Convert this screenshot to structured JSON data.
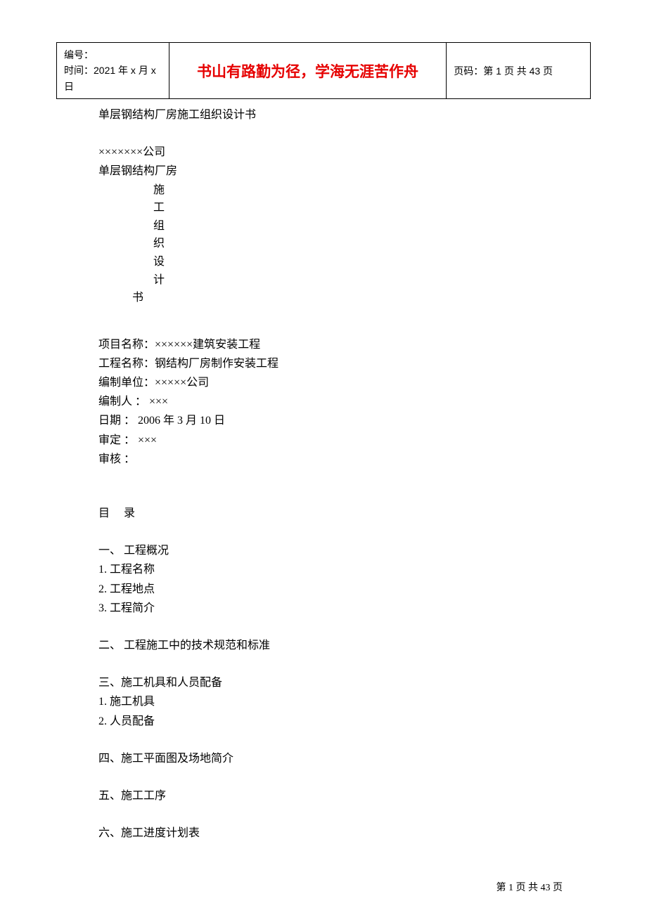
{
  "header": {
    "left_line1": "编号：",
    "left_line2": "时间：2021 年 x 月 x 日",
    "center": "书山有路勤为径，学海无涯苦作舟",
    "right": "页码：第 1 页  共 43 页"
  },
  "doc_title": "单层钢结构厂房施工组织设计书",
  "company_line": "×××××××公司",
  "subtitle": "单层钢结构厂房",
  "vertical_chars": [
    "施",
    "工",
    "组",
    "织",
    "设",
    "计"
  ],
  "vertical_last": "书",
  "info": {
    "project_name": "项目名称：××××××建筑安装工程",
    "engineering_name": "工程名称：钢结构厂房制作安装工程",
    "compile_unit": "编制单位：×××××公司",
    "compiler": "编制人  ：      ×××",
    "date": "日期  ：     2006 年 3 月 10 日",
    "approver": "审定  ：    ×××",
    "reviewer": "审核  ："
  },
  "toc_title": "目       录",
  "toc": {
    "sec1": {
      "head": "一、   工程概况",
      "items": [
        "1.             工程名称",
        "2.             工程地点",
        "3.             工程简介"
      ]
    },
    "sec2": "二、   工程施工中的技术规范和标准",
    "sec3": {
      "head": "三、施工机具和人员配备",
      "items": [
        "1.              施工机具",
        "2.              人员配备"
      ]
    },
    "sec4": "四、施工平面图及场地简介",
    "sec5": "五、施工工序",
    "sec6": "六、施工进度计划表"
  },
  "footer": "第  1  页  共  43  页"
}
